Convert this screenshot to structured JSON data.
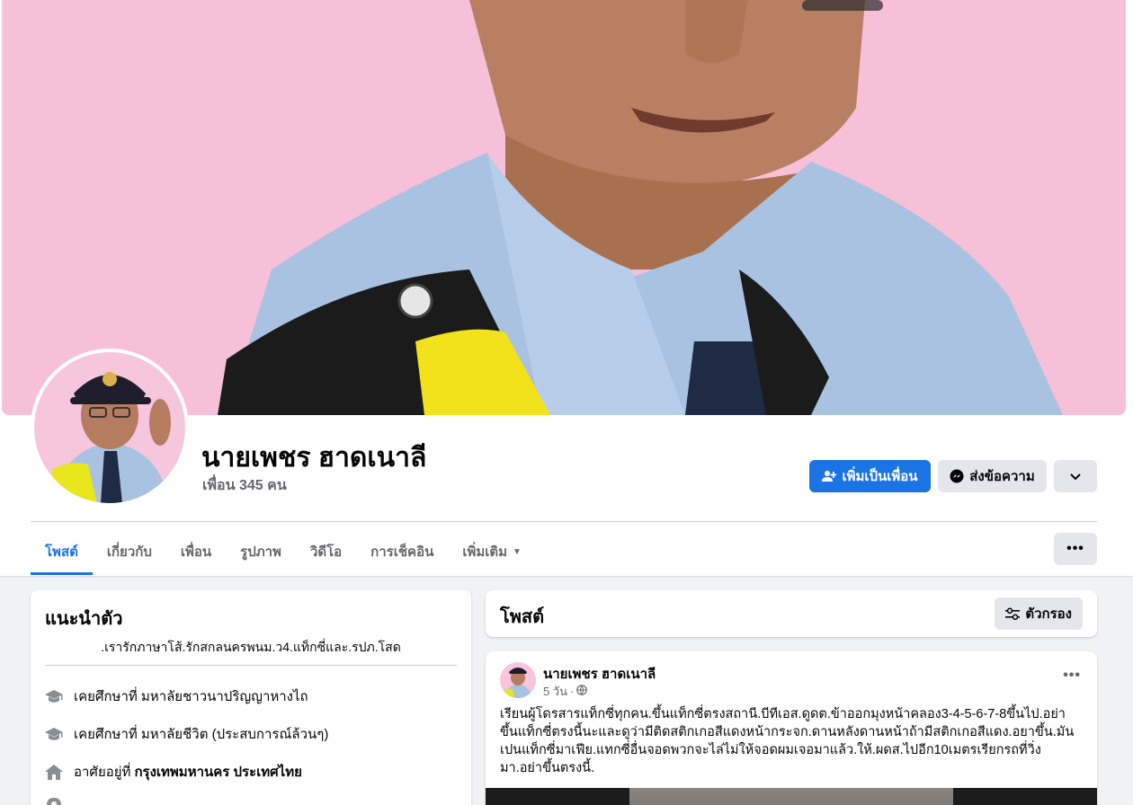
{
  "profile": {
    "name": "นายเพชร ฮาดเนาลี",
    "friends": "เพื่อน 345 คน"
  },
  "actions": {
    "add_friend": "เพิ่มเป็นเพื่อน",
    "message": "ส่งข้อความ"
  },
  "tabs": [
    {
      "label": "โพสต์",
      "active": true
    },
    {
      "label": "เกี่ยวกับ"
    },
    {
      "label": "เพื่อน"
    },
    {
      "label": "รูปภาพ"
    },
    {
      "label": "วิดีโอ"
    },
    {
      "label": "การเช็คอิน"
    },
    {
      "label": "เพิ่มเติม"
    }
  ],
  "intro": {
    "title": "แนะนำตัว",
    "bio": ".เรารักภาษาโส้.รักสกลนครพนม.ว4.แท็กซี่และ.รปภ.โสด",
    "items": [
      {
        "icon": "graduation-cap-icon",
        "text": "เคยศึกษาที่ มหาลัยชาวนาปริญญาหางไถ",
        "bold": ""
      },
      {
        "icon": "graduation-cap-icon",
        "text": "เคยศึกษาที่ มหาลัยชีวิต (ประสบการณ์ล้วนๆ)",
        "bold": ""
      },
      {
        "icon": "home-icon",
        "text": "อาศัยอยู่ที่",
        "bold": "กรุงเทพมหานคร ประเทศไทย"
      }
    ]
  },
  "posts_header": {
    "title": "โพสต์",
    "filter_label": "ตัวกรอง"
  },
  "post": {
    "author": "นายเพชร ฮาดเนาลี",
    "time": "5 วัน",
    "text": "เรียนผู้โดรสารแท็กซี่ทุกคน.ขึ้นแท็กซี่ตรงสถานี.บีทีเอส.ดูดต.ข้าออกมุงหน้าคลอง3-4-5-6-7-8ขึ้นไป.อย่าขึ้นแท็กซี่ตรงนี้นะและดูว่ามีติดสติกเกอสีแดงหน้ากระจก.ดานหลังดานหน้าถ้ามีสติกเกอสีแดง.อยาขึ้น.มันเปนแท็กซี่มาเฟีย.แทกซี่อื่นจอดพวกจะไล่ไม่ให้จอดผมเจอมาแล้ว.ให้.ผดส.ไปอีก10เมตรเรียกรถที่วิ่งมา.อย่าขึ้นตรงนี้."
  },
  "colors": {
    "accent": "#1b74e4",
    "secondary_button": "#e4e6eb",
    "page_bg": "#f0f2f5"
  }
}
